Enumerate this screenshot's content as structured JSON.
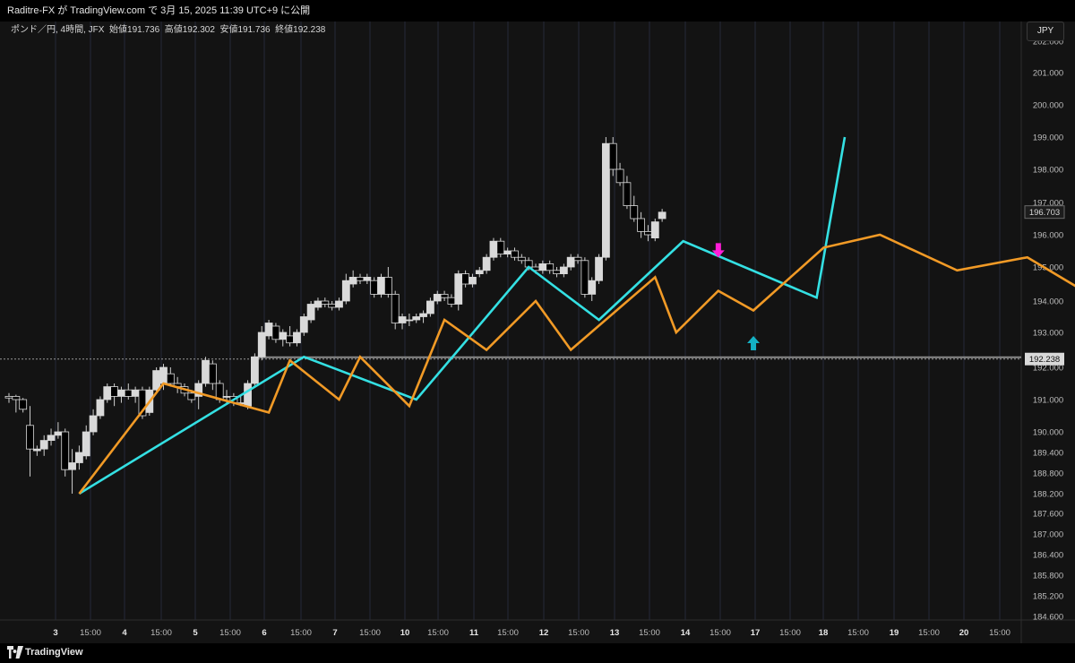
{
  "header": {
    "publish_line": "Raditre-FX が TradingView.com で 3月 15, 2025 11:39 UTC+9 に公開"
  },
  "legend": {
    "symbol": "ポンド／円, 4時間, JFX",
    "open_label": "始値",
    "open": "191.736",
    "high_label": "高値",
    "high": "192.302",
    "low_label": "安値",
    "low": "191.736",
    "close_label": "終値",
    "close": "192.238"
  },
  "currency_button": "JPY",
  "footer": {
    "brand": "TradingView"
  },
  "colors": {
    "background": "#131313",
    "bull_candle": "#d9d9d9",
    "bear_candle": "#000000",
    "zigzag_major": "#34e0e3",
    "zigzag_minor": "#f19a26",
    "sell_arrow": "#ff1dd8",
    "buy_arrow": "#14b1c4",
    "price_line": "#9a9a9a"
  },
  "chart_data": {
    "type": "candlestick",
    "y_axis_ticks": [
      "184.600",
      "185.200",
      "185.800",
      "186.400",
      "187.000",
      "187.600",
      "188.200",
      "188.800",
      "189.400",
      "190.000",
      "191.000",
      "192.000",
      "193.000",
      "194.000",
      "195.000",
      "196.000",
      "197.000",
      "198.000",
      "199.000",
      "200.000",
      "201.000",
      "202.000"
    ],
    "x_axis_labels": [
      "3",
      "15:00",
      "4",
      "15:00",
      "5",
      "15:00",
      "6",
      "15:00",
      "7",
      "15:00",
      "10",
      "15:00",
      "11",
      "15:00",
      "12",
      "15:00",
      "13",
      "15:00",
      "14",
      "15:00",
      "17",
      "15:00",
      "18",
      "15:00",
      "19",
      "15:00",
      "20",
      "15:00"
    ],
    "current_price_label": "192.238",
    "last_close_label": "196.703",
    "candles": [
      {
        "o": 191.1,
        "h": 191.2,
        "l": 190.9,
        "c": 191.05
      },
      {
        "o": 191.1,
        "h": 191.15,
        "l": 190.6,
        "c": 191.0
      },
      {
        "o": 191.0,
        "h": 191.05,
        "l": 190.6,
        "c": 190.7
      },
      {
        "o": 190.2,
        "h": 190.8,
        "l": 188.7,
        "c": 189.5
      },
      {
        "o": 189.45,
        "h": 189.6,
        "l": 189.3,
        "c": 189.5
      },
      {
        "o": 189.5,
        "h": 189.9,
        "l": 189.3,
        "c": 189.75
      },
      {
        "o": 189.75,
        "h": 190.1,
        "l": 189.6,
        "c": 189.9
      },
      {
        "o": 189.9,
        "h": 190.3,
        "l": 189.8,
        "c": 190.0
      },
      {
        "o": 190.0,
        "h": 190.1,
        "l": 188.7,
        "c": 188.9
      },
      {
        "o": 188.9,
        "h": 189.5,
        "l": 188.2,
        "c": 189.1
      },
      {
        "o": 189.1,
        "h": 189.6,
        "l": 188.9,
        "c": 189.4
      },
      {
        "o": 189.3,
        "h": 190.2,
        "l": 189.2,
        "c": 190.0
      },
      {
        "o": 190.0,
        "h": 190.7,
        "l": 189.9,
        "c": 190.5
      },
      {
        "o": 190.5,
        "h": 191.1,
        "l": 190.4,
        "c": 191.0
      },
      {
        "o": 191.0,
        "h": 191.5,
        "l": 190.9,
        "c": 191.4
      },
      {
        "o": 191.4,
        "h": 191.5,
        "l": 190.8,
        "c": 191.1
      },
      {
        "o": 191.1,
        "h": 191.4,
        "l": 190.9,
        "c": 191.3
      },
      {
        "o": 191.3,
        "h": 191.5,
        "l": 191.0,
        "c": 191.1
      },
      {
        "o": 191.1,
        "h": 191.4,
        "l": 190.9,
        "c": 191.3
      },
      {
        "o": 191.3,
        "h": 191.4,
        "l": 190.4,
        "c": 190.5
      },
      {
        "o": 190.6,
        "h": 191.4,
        "l": 190.5,
        "c": 191.3
      },
      {
        "o": 191.3,
        "h": 192.0,
        "l": 191.2,
        "c": 191.9
      },
      {
        "o": 191.5,
        "h": 192.1,
        "l": 191.3,
        "c": 192.0
      },
      {
        "o": 191.8,
        "h": 192.0,
        "l": 191.4,
        "c": 191.5
      },
      {
        "o": 191.5,
        "h": 191.7,
        "l": 191.2,
        "c": 191.4
      },
      {
        "o": 191.4,
        "h": 191.5,
        "l": 191.1,
        "c": 191.2
      },
      {
        "o": 191.2,
        "h": 191.3,
        "l": 190.9,
        "c": 191.0
      },
      {
        "o": 191.1,
        "h": 191.6,
        "l": 190.7,
        "c": 191.5
      },
      {
        "o": 191.5,
        "h": 192.3,
        "l": 191.4,
        "c": 192.2
      },
      {
        "o": 192.1,
        "h": 192.2,
        "l": 191.3,
        "c": 191.5
      },
      {
        "o": 191.5,
        "h": 191.6,
        "l": 190.9,
        "c": 191.0
      },
      {
        "o": 191.1,
        "h": 191.3,
        "l": 190.9,
        "c": 191.1
      },
      {
        "o": 191.1,
        "h": 191.2,
        "l": 190.8,
        "c": 190.9
      },
      {
        "o": 190.9,
        "h": 191.1,
        "l": 190.8,
        "c": 190.9
      },
      {
        "o": 190.8,
        "h": 191.6,
        "l": 190.7,
        "c": 191.5
      },
      {
        "o": 191.5,
        "h": 192.4,
        "l": 191.4,
        "c": 192.3
      },
      {
        "o": 192.3,
        "h": 193.2,
        "l": 192.2,
        "c": 193.0
      },
      {
        "o": 192.9,
        "h": 193.4,
        "l": 192.8,
        "c": 193.3
      },
      {
        "o": 193.2,
        "h": 193.3,
        "l": 192.7,
        "c": 192.8
      },
      {
        "o": 192.8,
        "h": 193.1,
        "l": 192.6,
        "c": 193.0
      },
      {
        "o": 192.9,
        "h": 193.2,
        "l": 192.6,
        "c": 192.7
      },
      {
        "o": 192.7,
        "h": 193.1,
        "l": 192.6,
        "c": 193.0
      },
      {
        "o": 193.0,
        "h": 193.6,
        "l": 192.9,
        "c": 193.5
      },
      {
        "o": 193.4,
        "h": 194.0,
        "l": 193.3,
        "c": 193.9
      },
      {
        "o": 193.8,
        "h": 194.1,
        "l": 193.7,
        "c": 194.0
      },
      {
        "o": 194.0,
        "h": 194.1,
        "l": 193.8,
        "c": 193.9
      },
      {
        "o": 193.9,
        "h": 194.0,
        "l": 193.7,
        "c": 193.8
      },
      {
        "o": 193.8,
        "h": 194.1,
        "l": 193.7,
        "c": 194.0
      },
      {
        "o": 194.0,
        "h": 194.8,
        "l": 193.9,
        "c": 194.6
      },
      {
        "o": 194.5,
        "h": 194.9,
        "l": 194.4,
        "c": 194.7
      },
      {
        "o": 194.7,
        "h": 194.8,
        "l": 194.5,
        "c": 194.6
      },
      {
        "o": 194.6,
        "h": 194.8,
        "l": 194.5,
        "c": 194.7
      },
      {
        "o": 194.6,
        "h": 194.7,
        "l": 194.1,
        "c": 194.2
      },
      {
        "o": 194.2,
        "h": 194.8,
        "l": 194.1,
        "c": 194.7
      },
      {
        "o": 194.7,
        "h": 195.0,
        "l": 194.1,
        "c": 194.2
      },
      {
        "o": 194.2,
        "h": 194.3,
        "l": 193.1,
        "c": 193.3
      },
      {
        "o": 193.3,
        "h": 193.6,
        "l": 193.1,
        "c": 193.5
      },
      {
        "o": 193.4,
        "h": 193.6,
        "l": 193.2,
        "c": 193.4
      },
      {
        "o": 193.4,
        "h": 193.6,
        "l": 193.3,
        "c": 193.5
      },
      {
        "o": 193.5,
        "h": 193.7,
        "l": 193.3,
        "c": 193.6
      },
      {
        "o": 193.6,
        "h": 194.1,
        "l": 193.5,
        "c": 194.0
      },
      {
        "o": 194.0,
        "h": 194.3,
        "l": 193.9,
        "c": 194.2
      },
      {
        "o": 194.2,
        "h": 194.3,
        "l": 194.0,
        "c": 194.1
      },
      {
        "o": 194.1,
        "h": 194.2,
        "l": 193.8,
        "c": 193.9
      },
      {
        "o": 193.9,
        "h": 194.9,
        "l": 193.7,
        "c": 194.8
      },
      {
        "o": 194.8,
        "h": 194.9,
        "l": 194.4,
        "c": 194.5
      },
      {
        "o": 194.5,
        "h": 194.8,
        "l": 194.4,
        "c": 194.7
      },
      {
        "o": 194.8,
        "h": 195.0,
        "l": 194.7,
        "c": 194.9
      },
      {
        "o": 194.9,
        "h": 195.4,
        "l": 194.8,
        "c": 195.3
      },
      {
        "o": 195.3,
        "h": 195.9,
        "l": 195.2,
        "c": 195.8
      },
      {
        "o": 195.8,
        "h": 195.9,
        "l": 195.3,
        "c": 195.4
      },
      {
        "o": 195.4,
        "h": 195.6,
        "l": 195.3,
        "c": 195.5
      },
      {
        "o": 195.5,
        "h": 195.6,
        "l": 195.2,
        "c": 195.3
      },
      {
        "o": 195.3,
        "h": 195.4,
        "l": 195.1,
        "c": 195.2
      },
      {
        "o": 195.2,
        "h": 195.3,
        "l": 194.9,
        "c": 195.0
      },
      {
        "o": 195.0,
        "h": 195.1,
        "l": 194.8,
        "c": 194.9
      },
      {
        "o": 194.9,
        "h": 195.2,
        "l": 194.8,
        "c": 195.1
      },
      {
        "o": 195.1,
        "h": 195.2,
        "l": 194.8,
        "c": 194.9
      },
      {
        "o": 194.9,
        "h": 195.0,
        "l": 194.7,
        "c": 194.8
      },
      {
        "o": 194.8,
        "h": 195.1,
        "l": 194.7,
        "c": 195.0
      },
      {
        "o": 195.0,
        "h": 195.4,
        "l": 194.9,
        "c": 195.3
      },
      {
        "o": 195.3,
        "h": 195.4,
        "l": 195.1,
        "c": 195.2
      },
      {
        "o": 195.2,
        "h": 195.3,
        "l": 194.1,
        "c": 194.2
      },
      {
        "o": 194.2,
        "h": 194.7,
        "l": 194.0,
        "c": 194.6
      },
      {
        "o": 194.6,
        "h": 195.4,
        "l": 194.5,
        "c": 195.3
      },
      {
        "o": 195.3,
        "h": 199.0,
        "l": 195.2,
        "c": 198.8
      },
      {
        "o": 198.8,
        "h": 199.0,
        "l": 197.8,
        "c": 198.0
      },
      {
        "o": 198.0,
        "h": 198.2,
        "l": 197.5,
        "c": 197.6
      },
      {
        "o": 197.6,
        "h": 197.8,
        "l": 196.8,
        "c": 196.9
      },
      {
        "o": 196.9,
        "h": 197.2,
        "l": 196.4,
        "c": 196.5
      },
      {
        "o": 196.5,
        "h": 196.7,
        "l": 195.9,
        "c": 196.1
      },
      {
        "o": 196.1,
        "h": 196.3,
        "l": 195.8,
        "c": 196.0
      },
      {
        "o": 195.9,
        "h": 196.5,
        "l": 195.8,
        "c": 196.4
      },
      {
        "o": 196.5,
        "h": 196.8,
        "l": 196.4,
        "c": 196.7
      }
    ],
    "zigzag_major": [
      [
        10,
        188.2
      ],
      [
        42,
        192.3
      ],
      [
        58,
        191.0
      ],
      [
        74,
        195.0
      ],
      [
        84,
        193.4
      ],
      [
        96,
        195.8
      ],
      [
        115,
        194.1
      ],
      [
        119,
        199.0
      ]
    ],
    "zigzag_minor": [
      [
        10,
        188.2
      ],
      [
        22,
        191.5
      ],
      [
        37,
        190.6
      ],
      [
        40,
        192.2
      ],
      [
        47,
        191.0
      ],
      [
        50,
        192.3
      ],
      [
        57,
        190.8
      ],
      [
        62,
        193.4
      ],
      [
        68,
        192.5
      ],
      [
        75,
        194.0
      ],
      [
        80,
        192.5
      ],
      [
        92,
        194.7
      ],
      [
        95,
        193.0
      ],
      [
        101,
        194.3
      ],
      [
        106,
        193.7
      ],
      [
        116,
        195.6
      ],
      [
        124,
        196.0
      ],
      [
        135,
        194.9
      ],
      [
        145,
        195.3
      ],
      [
        153,
        194.3
      ],
      [
        161,
        198.9
      ]
    ],
    "signals": [
      {
        "type": "sell",
        "at": 101,
        "price": 194.7
      },
      {
        "type": "buy",
        "at": 106,
        "price": 193.0
      }
    ]
  }
}
